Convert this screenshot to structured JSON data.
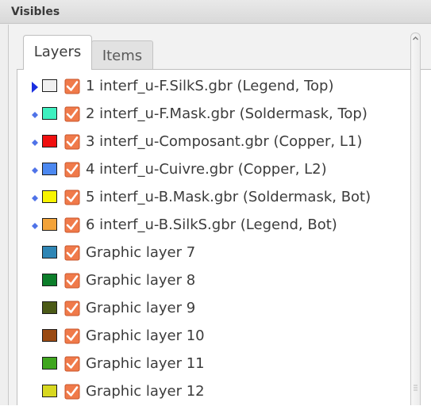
{
  "panel": {
    "title": "Visibles"
  },
  "tabs": [
    {
      "label": "Layers",
      "active": true
    },
    {
      "label": "Items",
      "active": false
    }
  ],
  "colors": {
    "indicator_active": "#1a2fe0",
    "indicator_diamond": "#4f73e8",
    "checkbox_fill": "#f07a4a",
    "checkbox_border": "#c9562b"
  },
  "layers": [
    {
      "label": "1 interf_u-F.SilkS.gbr (Legend, Top)",
      "color": "#f0f0f0",
      "indicator": "arrow",
      "checked": true
    },
    {
      "label": "2 interf_u-F.Mask.gbr (Soldermask, Top)",
      "color": "#3ef0c0",
      "indicator": "diamond",
      "checked": true
    },
    {
      "label": "3 interf_u-Composant.gbr (Copper, L1)",
      "color": "#f01010",
      "indicator": "diamond",
      "checked": true
    },
    {
      "label": "4 interf_u-Cuivre.gbr (Copper, L2)",
      "color": "#4c88f0",
      "indicator": "diamond",
      "checked": true
    },
    {
      "label": "5 interf_u-B.Mask.gbr (Soldermask, Bot)",
      "color": "#f8f400",
      "indicator": "diamond",
      "checked": true
    },
    {
      "label": "6 interf_u-B.SilkS.gbr (Legend, Bot)",
      "color": "#f3a33a",
      "indicator": "diamond",
      "checked": true
    },
    {
      "label": "Graphic layer 7",
      "color": "#2f86b5",
      "indicator": "none",
      "checked": true
    },
    {
      "label": "Graphic layer 8",
      "color": "#0c7e2a",
      "indicator": "none",
      "checked": true
    },
    {
      "label": "Graphic layer 9",
      "color": "#4b5a17",
      "indicator": "none",
      "checked": true
    },
    {
      "label": "Graphic layer 10",
      "color": "#9a4a12",
      "indicator": "none",
      "checked": true
    },
    {
      "label": "Graphic layer 11",
      "color": "#3fa61e",
      "indicator": "none",
      "checked": true
    },
    {
      "label": "Graphic layer 12",
      "color": "#d8d820",
      "indicator": "none",
      "checked": true
    }
  ]
}
